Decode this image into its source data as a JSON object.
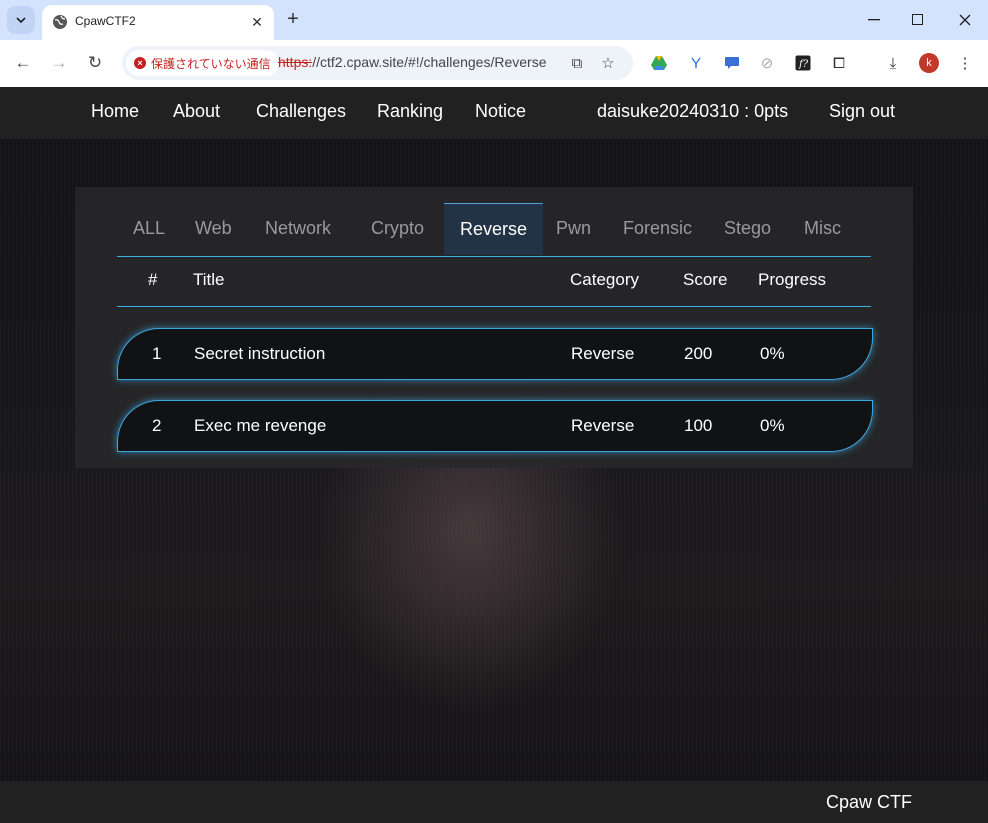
{
  "browser": {
    "tab_title": "CpawCTF2",
    "security_label": "保護されていない通信",
    "url_scheme": "https:",
    "url_rest": "//ctf2.cpaw.site/#!/challenges/Reverse",
    "profile_initial": "k"
  },
  "site": {
    "nav": {
      "home": "Home",
      "about": "About",
      "challenges": "Challenges",
      "ranking": "Ranking",
      "notice": "Notice",
      "user_status": "daisuke20240310 : 0pts",
      "sign_out": "Sign out"
    },
    "categories": [
      "ALL",
      "Web",
      "Network",
      "Crypto",
      "Reverse",
      "Pwn",
      "Forensic",
      "Stego",
      "Misc"
    ],
    "active_category": "Reverse",
    "table": {
      "headers": {
        "num": "#",
        "title": "Title",
        "category": "Category",
        "score": "Score",
        "progress": "Progress"
      },
      "rows": [
        {
          "num": "1",
          "title": "Secret instruction",
          "category": "Reverse",
          "score": "200",
          "progress": "0%"
        },
        {
          "num": "2",
          "title": "Exec me revenge",
          "category": "Reverse",
          "score": "100",
          "progress": "0%"
        }
      ]
    },
    "footer": "Cpaw CTF"
  },
  "colors": {
    "accent": "#3fa7e0",
    "active_tab_bg": "#233346",
    "header_bg": "#212121"
  }
}
